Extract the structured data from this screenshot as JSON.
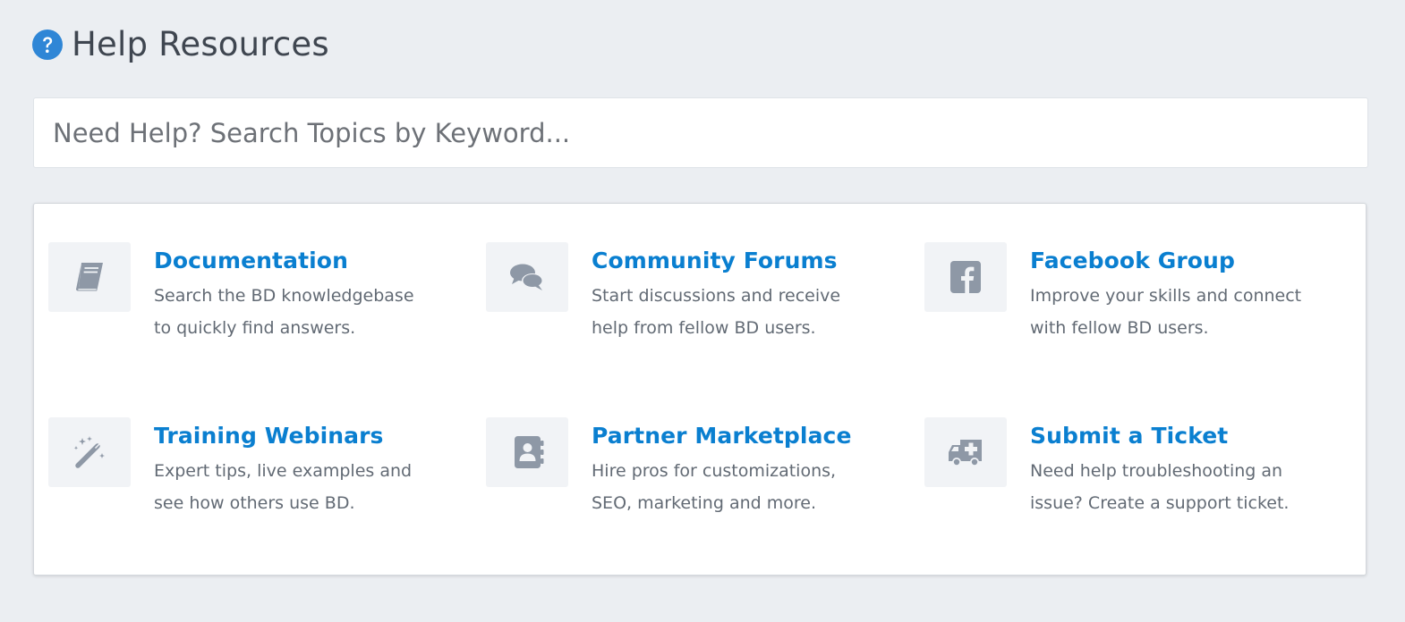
{
  "header": {
    "title": "Help Resources",
    "icon": "question-circle-icon",
    "icon_color": "#2f86d6"
  },
  "search": {
    "placeholder": "Need Help? Search Topics by Keyword...",
    "value": ""
  },
  "theme": {
    "link_color": "#0a7fd0",
    "icon_color": "#8e98a6",
    "tile_bg": "#f1f3f6",
    "page_bg": "#ebeef2"
  },
  "resources": [
    {
      "title": "Documentation",
      "line1": "Search the BD knowledgebase",
      "line2": "to quickly find answers.",
      "icon": "book-icon"
    },
    {
      "title": "Community Forums",
      "line1": "Start discussions and receive",
      "line2": "help from fellow BD users.",
      "icon": "comments-icon"
    },
    {
      "title": "Facebook Group",
      "line1": "Improve your skills and connect",
      "line2": "with fellow BD users.",
      "icon": "facebook-icon"
    },
    {
      "title": "Training Webinars",
      "line1": "Expert tips, live examples and",
      "line2": "see how others use BD.",
      "icon": "magic-wand-icon"
    },
    {
      "title": "Partner Marketplace",
      "line1": "Hire pros for customizations,",
      "line2": "SEO, marketing and more.",
      "icon": "address-book-icon"
    },
    {
      "title": "Submit a Ticket",
      "line1": "Need help troubleshooting an",
      "line2": "issue? Create a support ticket.",
      "icon": "ambulance-icon"
    }
  ]
}
